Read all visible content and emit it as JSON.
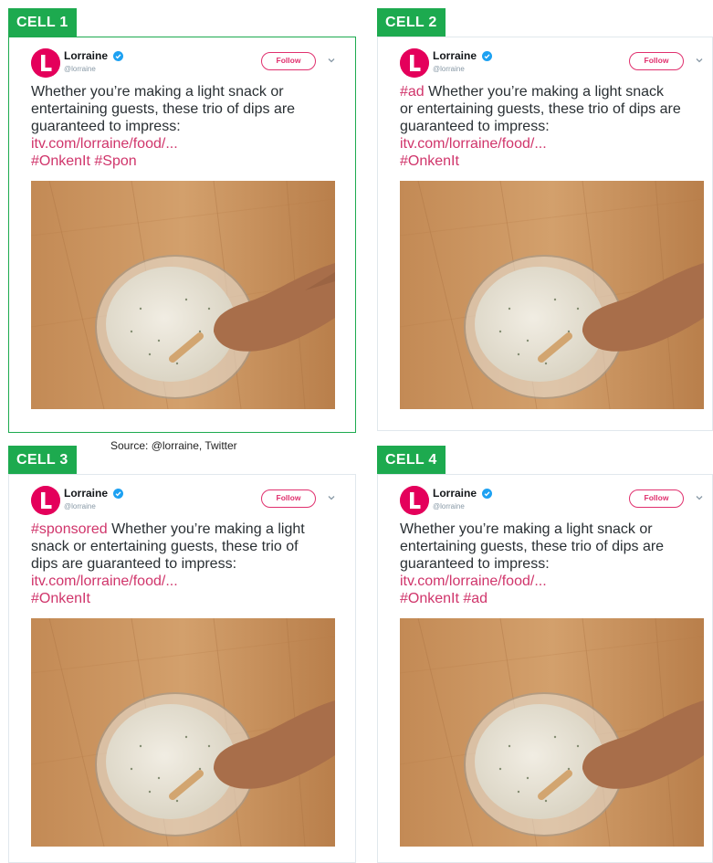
{
  "source_caption": "Source: @lorraine, Twitter",
  "colors": {
    "tag_green": "#1daa4f",
    "link_pink": "#d0356b",
    "brand_pink": "#e4005b"
  },
  "cells": [
    {
      "tag": "CELL 1",
      "tweet": {
        "author_name": "Lorraine",
        "author_handle": "@lorraine",
        "follow_label": "Follow",
        "verified_icon": "verified-badge-icon",
        "more_icon": "chevron-down-icon",
        "lines": [
          {
            "text": "Whether you’re making a light snack or"
          },
          {
            "text": "entertaining guests, these trio of dips are"
          },
          {
            "text": "guaranteed to impress:"
          },
          {
            "link": "itv.com/lorraine/food/..."
          },
          {
            "link": "#OnkenIt #Spon"
          }
        ],
        "media_description_icon": "video-thumbnail-icon"
      }
    },
    {
      "tag": "CELL 2",
      "tweet": {
        "author_name": "Lorraine",
        "author_handle": "@lorraine",
        "follow_label": "Follow",
        "verified_icon": "verified-badge-icon",
        "more_icon": "chevron-down-icon",
        "lines": [
          {
            "link": "#ad",
            "text": " Whether you’re making a light snack"
          },
          {
            "text": "or entertaining guests, these trio of dips are"
          },
          {
            "text": "guaranteed to impress:"
          },
          {
            "link": "itv.com/lorraine/food/..."
          },
          {
            "link": "#OnkenIt"
          }
        ],
        "media_description_icon": "video-thumbnail-icon"
      }
    },
    {
      "tag": "CELL 3",
      "tweet": {
        "author_name": "Lorraine",
        "author_handle": "@lorraine",
        "follow_label": "Follow",
        "verified_icon": "verified-badge-icon",
        "more_icon": "chevron-down-icon",
        "lines": [
          {
            "link": "#sponsored",
            "text": " Whether you’re making a light"
          },
          {
            "text": "snack or entertaining guests, these trio of"
          },
          {
            "text": "dips are guaranteed to impress:"
          },
          {
            "link": "itv.com/lorraine/food/..."
          },
          {
            "link": "#OnkenIt"
          }
        ],
        "media_description_icon": "video-thumbnail-icon"
      }
    },
    {
      "tag": "CELL 4",
      "tweet": {
        "author_name": "Lorraine",
        "author_handle": "@lorraine",
        "follow_label": "Follow",
        "verified_icon": "verified-badge-icon",
        "more_icon": "chevron-down-icon",
        "lines": [
          {
            "text": "Whether you’re making a light snack or"
          },
          {
            "text": "entertaining guests, these trio of dips are"
          },
          {
            "text": "guaranteed to impress:"
          },
          {
            "link": "itv.com/lorraine/food/..."
          },
          {
            "link": "#OnkenIt #ad"
          }
        ],
        "media_description_icon": "video-thumbnail-icon"
      }
    }
  ]
}
